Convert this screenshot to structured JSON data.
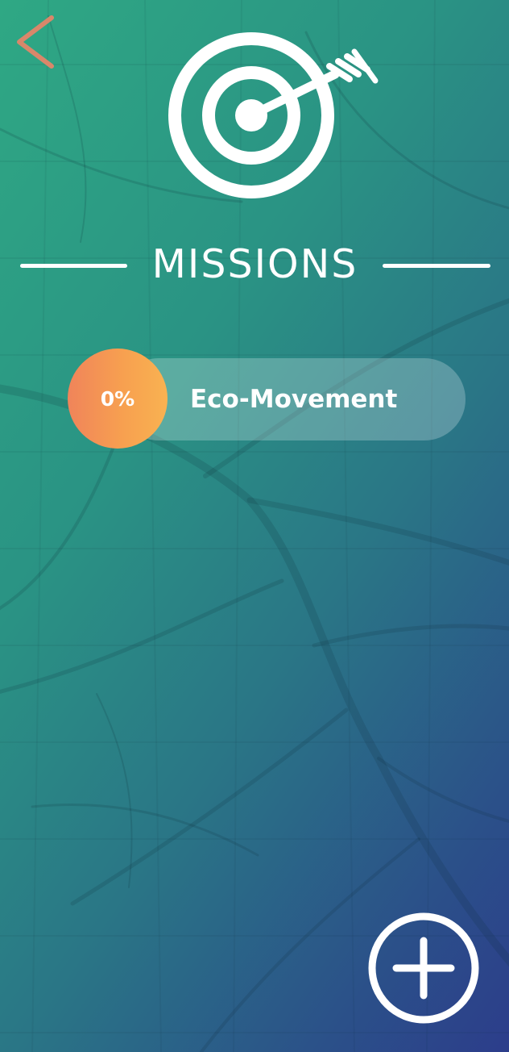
{
  "header": {
    "back_icon": "chevron-left-icon",
    "hero_icon": "target-arrow-icon",
    "title": "MISSIONS"
  },
  "missions": [
    {
      "progress_label": "0%",
      "progress": 0,
      "name": "Eco-Movement"
    }
  ],
  "fab": {
    "icon": "plus-icon"
  },
  "colors": {
    "gradient_start": "#2fa884",
    "gradient_end": "#2c3d8b",
    "back_arrow": "#d9876a",
    "badge_start": "#f0845a",
    "badge_end": "#f9b251",
    "foreground": "#ffffff"
  }
}
